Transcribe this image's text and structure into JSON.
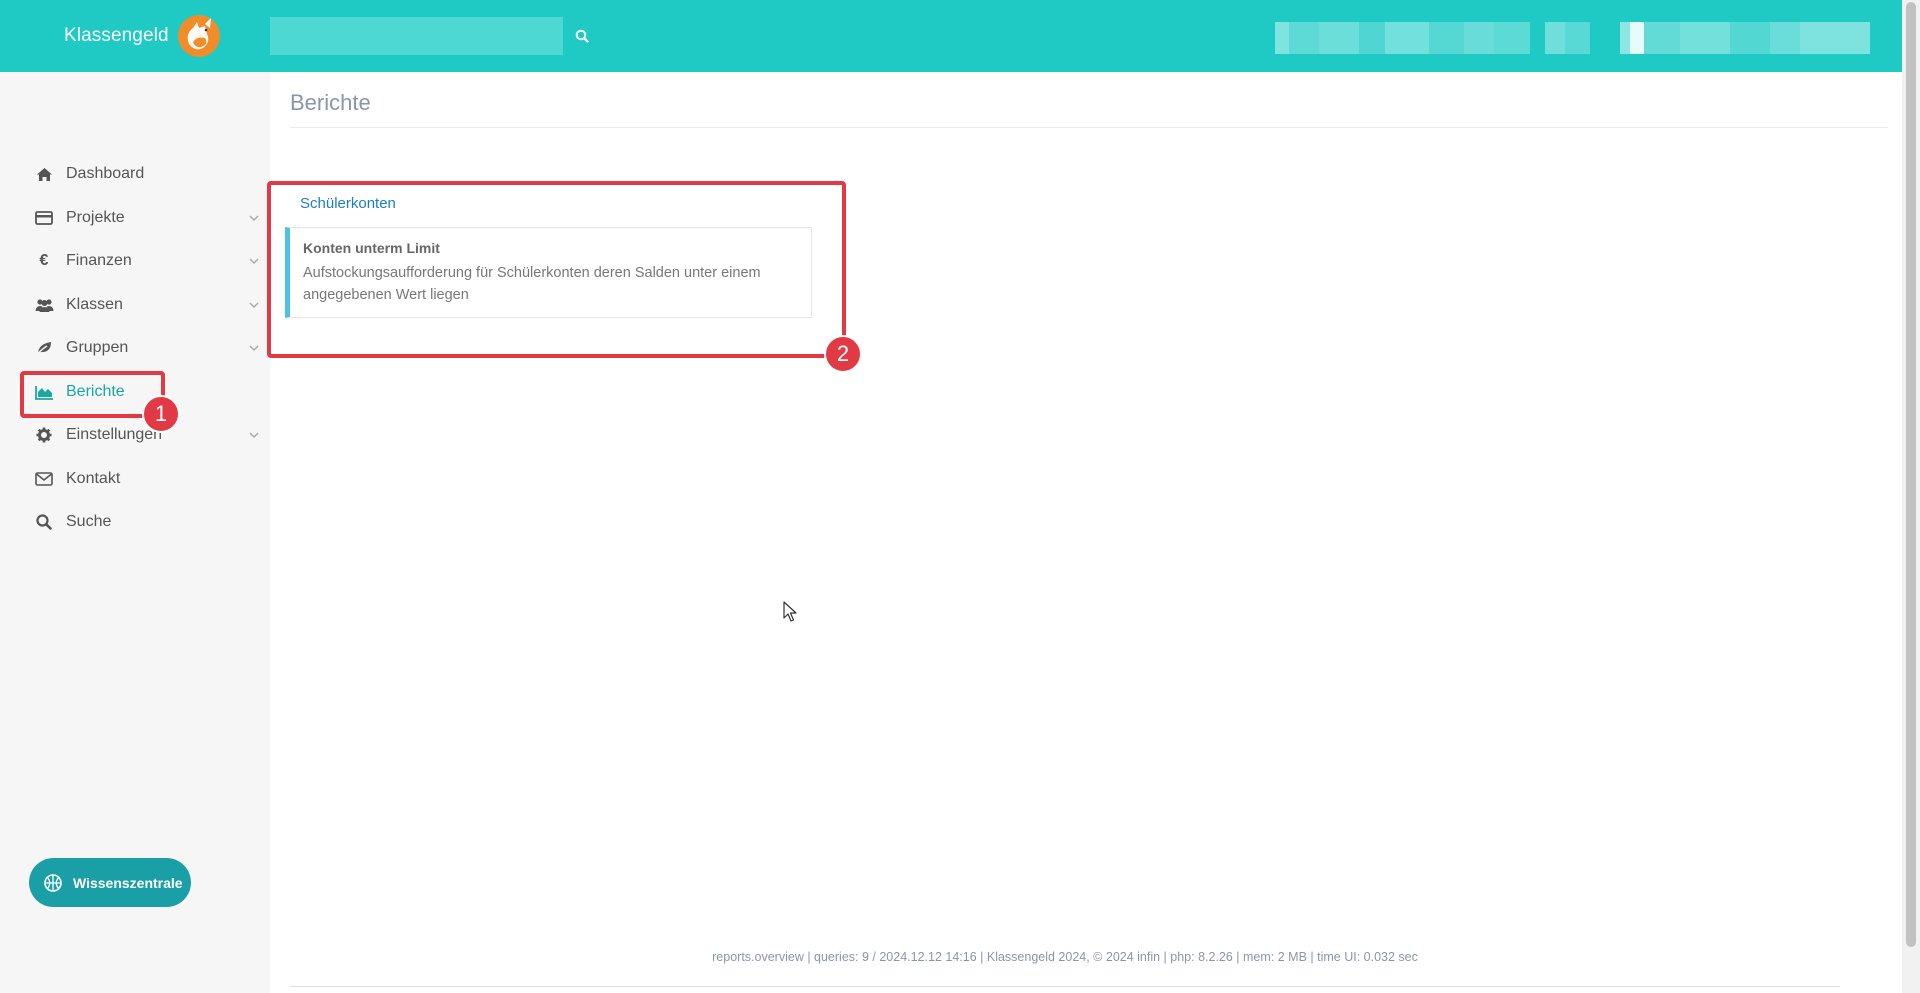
{
  "app": {
    "brand_name": "Klassengeld",
    "accent_color": "#1fcac5",
    "active_color": "#17a9a4",
    "annotation_color": "#e23a45"
  },
  "search": {
    "placeholder": "",
    "icon": "search-icon"
  },
  "sidebar": {
    "items": [
      {
        "label": "Dashboard",
        "icon": "home-icon",
        "has_submenu": false
      },
      {
        "label": "Projekte",
        "icon": "credit-card-icon",
        "has_submenu": true
      },
      {
        "label": "Finanzen",
        "icon": "euro-icon",
        "has_submenu": true
      },
      {
        "label": "Klassen",
        "icon": "users-icon",
        "has_submenu": true
      },
      {
        "label": "Gruppen",
        "icon": "leaf-icon",
        "has_submenu": true
      },
      {
        "label": "Berichte",
        "icon": "area-chart-icon",
        "has_submenu": false,
        "active": true
      },
      {
        "label": "Einstellungen",
        "icon": "gear-icon",
        "has_submenu": true
      },
      {
        "label": "Kontakt",
        "icon": "envelope-icon",
        "has_submenu": false
      },
      {
        "label": "Suche",
        "icon": "search-icon",
        "has_submenu": false
      }
    ],
    "wissen_button": "Wissenszentrale"
  },
  "main": {
    "page_title": "Berichte",
    "section_title": "Schülerkonten",
    "reports": [
      {
        "title": "Konten unterm Limit",
        "description": "Aufstockungsaufforderung für Schülerkonten deren Salden unter einem angegebenen Wert liegen"
      }
    ]
  },
  "annotations": [
    {
      "label": "1"
    },
    {
      "label": "2"
    }
  ],
  "footer": {
    "text": "reports.overview | queries: 9 / 2024.12.12 14:16 | Klassengeld 2024, © 2024 infin | php: 8.2.26 | mem: 2 MB | time UI: 0.032 sec"
  }
}
